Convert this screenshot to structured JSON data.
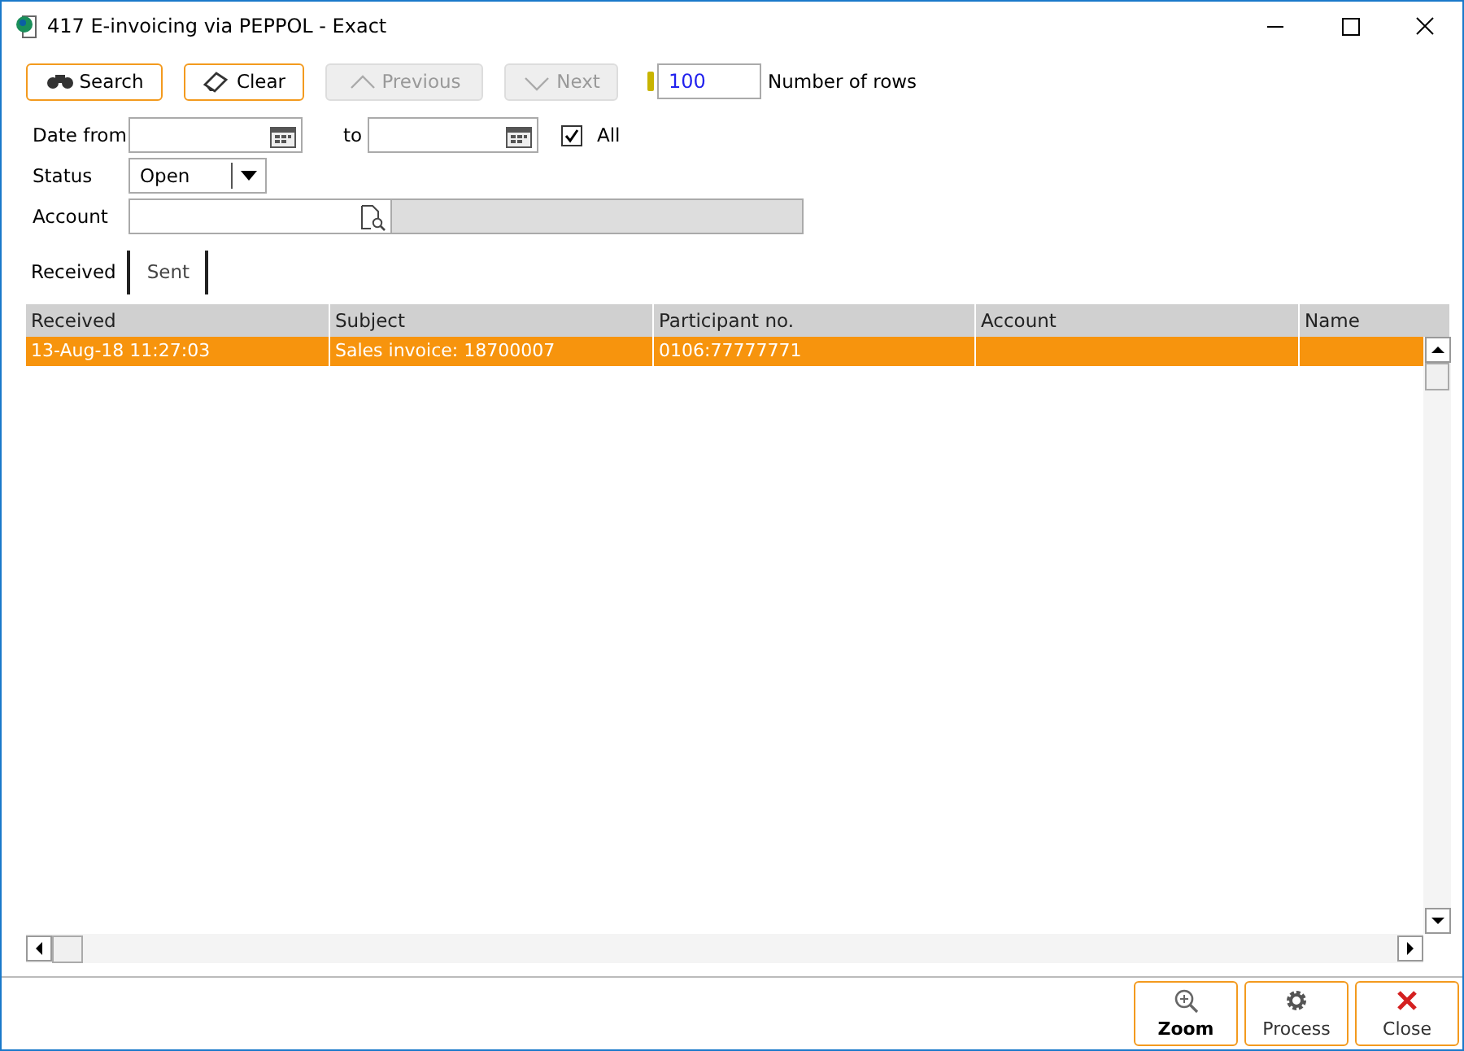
{
  "window": {
    "title": "417 E-invoicing via PEPPOL - Exact"
  },
  "toolbar": {
    "buttons": [
      {
        "label": "Search",
        "kind": "search",
        "disabled": false
      },
      {
        "label": "Clear",
        "kind": "clear",
        "disabled": false
      },
      {
        "label": "Previous",
        "kind": "previous",
        "disabled": true
      },
      {
        "label": "Next",
        "kind": "next",
        "disabled": true
      }
    ],
    "rows_value": "100",
    "rows_label": "Number of rows"
  },
  "filters": {
    "date_from_label": "Date from",
    "to_label": "to",
    "all_label": "All",
    "all_checked": true,
    "status_label": "Status",
    "status_value": "Open",
    "account_label": "Account"
  },
  "tabs": [
    {
      "label": "Received",
      "selected": true
    },
    {
      "label": "Sent",
      "selected": false
    }
  ],
  "table": {
    "columns": [
      "Received",
      "Subject",
      "Participant no.",
      "Account",
      "Name"
    ],
    "rows": [
      {
        "cells": [
          "13-Aug-18 11:27:03",
          "Sales invoice: 18700007",
          "0106:77777771",
          "",
          ""
        ],
        "selected": true
      }
    ]
  },
  "footer_buttons": [
    {
      "label": "Zoom",
      "kind": "zoom"
    },
    {
      "label": "Process",
      "kind": "process"
    },
    {
      "label": "Close",
      "kind": "close"
    }
  ]
}
